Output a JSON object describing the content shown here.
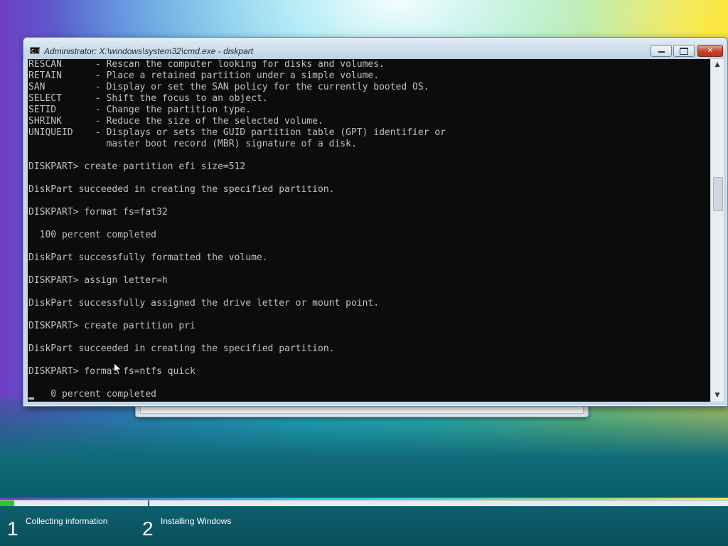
{
  "window": {
    "title": "Administrator: X:\\windows\\system32\\cmd.exe - diskpart",
    "icon_label": "C:\\",
    "icons": [
      "cmd-icon",
      "minimize-icon",
      "maximize-icon",
      "close-icon"
    ]
  },
  "console": {
    "lines": [
      "RESCAN      - Rescan the computer looking for disks and volumes.",
      "RETAIN      - Place a retained partition under a simple volume.",
      "SAN         - Display or set the SAN policy for the currently booted OS.",
      "SELECT      - Shift the focus to an object.",
      "SETID       - Change the partition type.",
      "SHRINK      - Reduce the size of the selected volume.",
      "UNIQUEID    - Displays or sets the GUID partition table (GPT) identifier or",
      "              master boot record (MBR) signature of a disk.",
      "",
      "DISKPART> create partition efi size=512",
      "",
      "DiskPart succeeded in creating the specified partition.",
      "",
      "DISKPART> format fs=fat32",
      "",
      "  100 percent completed",
      "",
      "DiskPart successfully formatted the volume.",
      "",
      "DISKPART> assign letter=h",
      "",
      "DiskPart successfully assigned the drive letter or mount point.",
      "",
      "DISKPART> create partition pri",
      "",
      "DiskPart succeeded in creating the specified partition.",
      "",
      "DISKPART> format fs=ntfs quick",
      "",
      "    0 percent completed"
    ]
  },
  "scrollbar": {
    "up_glyph": "▲",
    "down_glyph": "▼"
  },
  "setup": {
    "progress_fraction": 0.02,
    "steps": [
      {
        "number": "1",
        "label": "Collecting information"
      },
      {
        "number": "2",
        "label": "Installing Windows"
      }
    ],
    "colors": {
      "progress": "#34c12c",
      "bar": "#0d5f6e"
    }
  }
}
